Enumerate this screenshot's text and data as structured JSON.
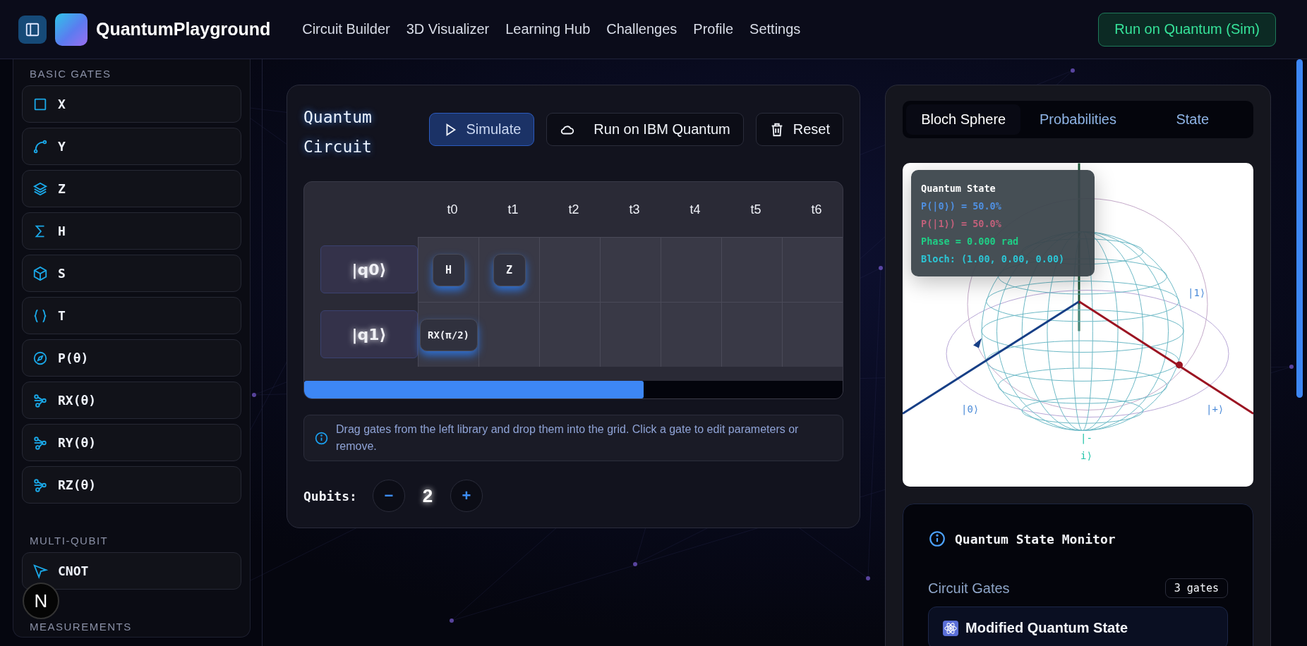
{
  "header": {
    "brand": "QuantumPlayground",
    "nav": [
      "Circuit Builder",
      "3D Visualizer",
      "Learning Hub",
      "Challenges",
      "Profile",
      "Settings"
    ],
    "action": "Run on Quantum (Sim)"
  },
  "sidebar": {
    "sections": [
      {
        "title": "BASIC GATES",
        "gates": [
          "X",
          "Y",
          "Z",
          "H",
          "S",
          "T",
          "P(θ)",
          "RX(θ)",
          "RY(θ)",
          "RZ(θ)"
        ]
      },
      {
        "title": "MULTI-QUBIT",
        "gates": [
          "CNOT"
        ]
      },
      {
        "title": "MEASUREMENTS"
      }
    ]
  },
  "dev_badge": "N",
  "circuit": {
    "title": "Quantum Circuit",
    "buttons": [
      {
        "label": "Simulate",
        "kind": "play"
      },
      {
        "label": "Run on IBM Quantum",
        "kind": "cloud"
      },
      {
        "label": "Reset",
        "kind": "trash"
      }
    ],
    "time_steps": [
      "t0",
      "t1",
      "t2",
      "t3",
      "t4",
      "t5",
      "t6"
    ],
    "qubits": [
      {
        "label": "|q0⟩",
        "cells": [
          {
            "kind": "gate",
            "gate": "H"
          },
          {
            "kind": "gate",
            "gate": "Z"
          },
          {
            "kind": "empty"
          },
          {
            "kind": "empty"
          },
          {
            "kind": "empty"
          },
          {
            "kind": "empty"
          },
          {
            "kind": "empty"
          }
        ]
      },
      {
        "label": "|q1⟩",
        "cells": [
          {
            "kind": "gate",
            "gate": "RX(π/2)"
          },
          {
            "kind": "empty"
          },
          {
            "kind": "empty"
          },
          {
            "kind": "empty"
          },
          {
            "kind": "empty"
          },
          {
            "kind": "empty"
          },
          {
            "kind": "empty"
          }
        ]
      }
    ],
    "hint": "Drag gates from the left library and drop them into the grid. Click a gate to edit parameters or remove.",
    "qubit_label": "Qubits:",
    "qubit_count": "2",
    "decrement": "−",
    "increment": "+"
  },
  "visualizer": {
    "tabs": [
      {
        "label": "Bloch Sphere",
        "selected": true
      },
      {
        "label": "Probabilities",
        "selected": false
      },
      {
        "label": "State",
        "selected": false
      }
    ],
    "axis_labels": [
      "|0⟩",
      "|+⟩",
      "|1⟩",
      "|-i⟩"
    ],
    "tooltip": {
      "title": "Quantum State",
      "lines": [
        {
          "text": "P(|0⟩) = 50.0%",
          "color": "#4f8fe0"
        },
        {
          "text": "P(|1⟩) = 50.0%",
          "color": "#c0607a"
        },
        {
          "text": "Phase = 0.000 rad",
          "color": "#1fcf86"
        },
        {
          "text": "Bloch: (1.00, 0.00, 0.00)",
          "color": "#2cc6d6"
        }
      ]
    }
  },
  "monitor": {
    "title": "Quantum State Monitor",
    "gates_label": "Circuit Gates",
    "gate_count": "3 gates",
    "card_title": "Modified Quantum State"
  }
}
